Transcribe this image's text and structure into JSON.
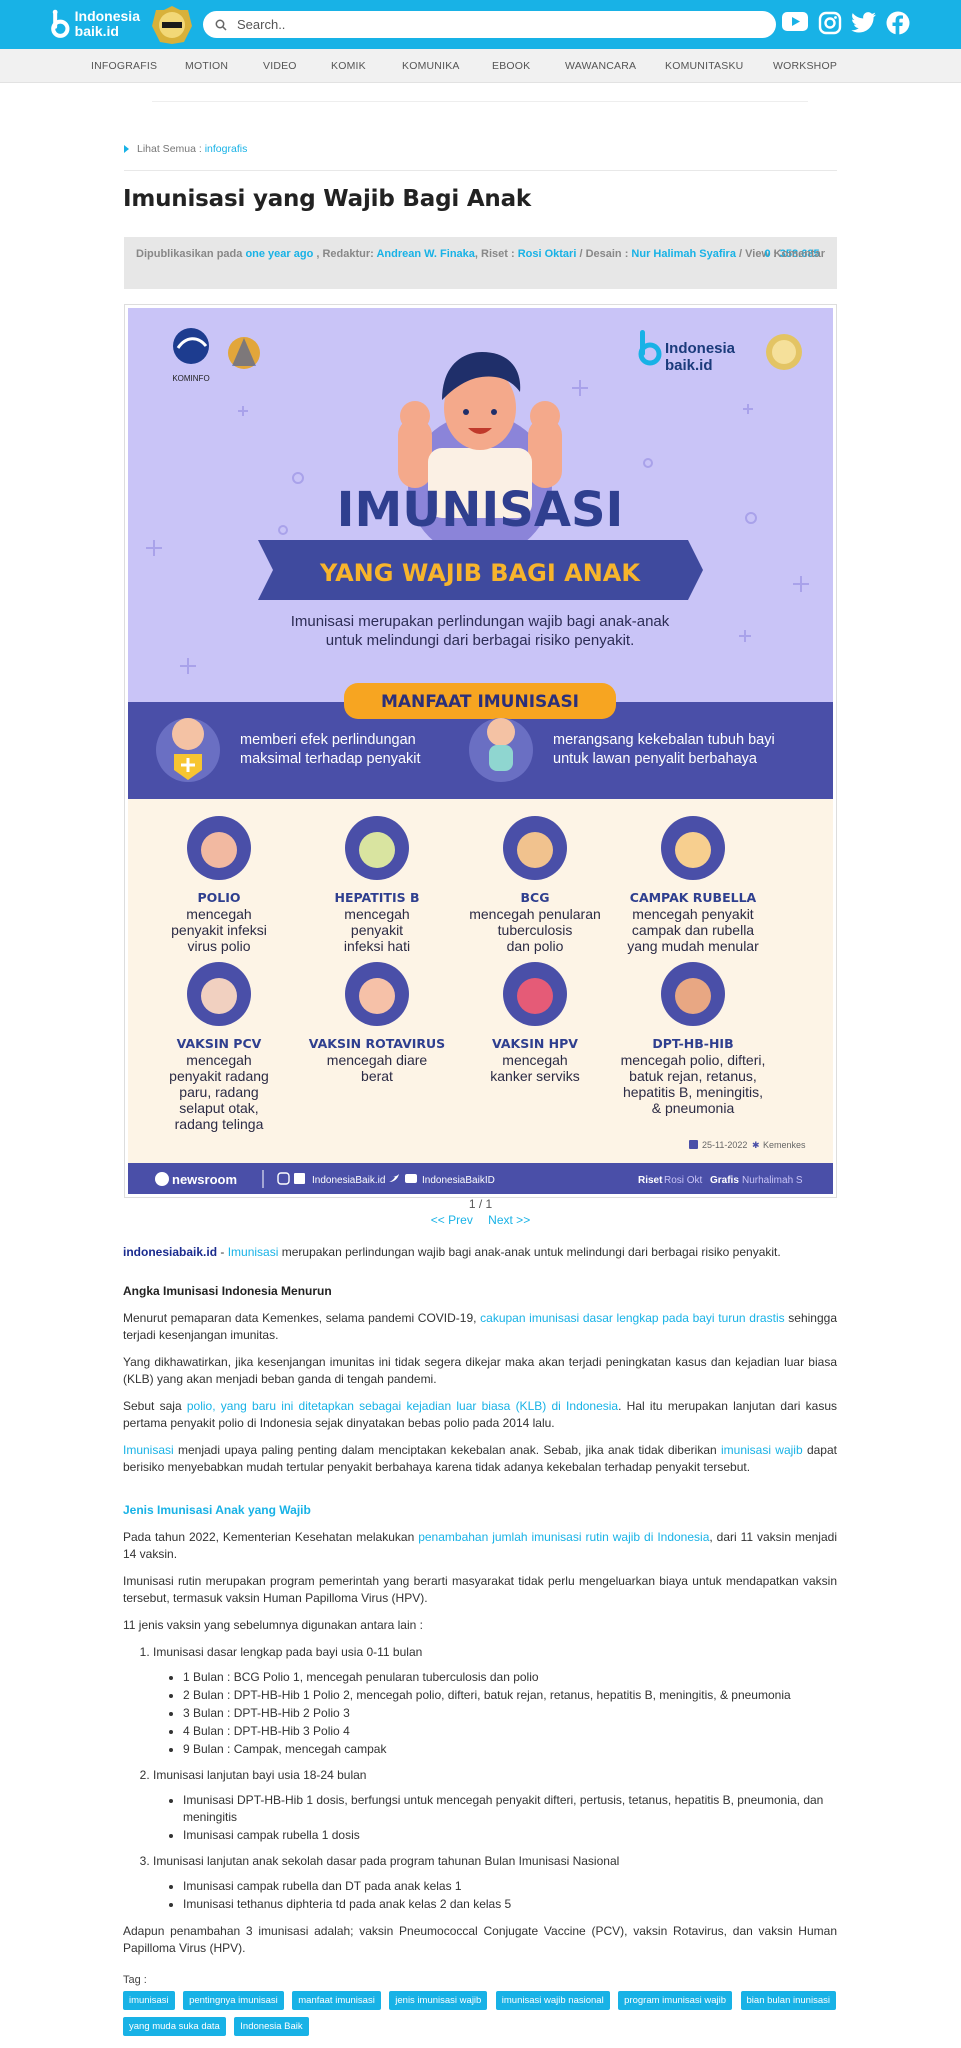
{
  "header": {
    "logo_text_1": "Indonesia",
    "logo_text_2": "baik.id",
    "search_placeholder": "Search..",
    "social": [
      "youtube-icon",
      "instagram-icon",
      "twitter-icon",
      "facebook-icon"
    ],
    "brand_color": "#18b2e6"
  },
  "nav": {
    "items": [
      "INFOGRAFIS",
      "MOTION",
      "VIDEO",
      "KOMIK",
      "KOMUNIKA",
      "EBOOK",
      "WAWANCARA",
      "KOMUNITASKU",
      "WORKSHOP"
    ]
  },
  "breadcrumb": {
    "prefix": "Lihat Semua : ",
    "link": "infografis"
  },
  "article": {
    "title": "Imunisasi yang Wajib Bagi Anak",
    "meta": {
      "published_label": "Dipublikasikan pada",
      "published_value": "one year ago",
      "editor_label": ", Redaktur:",
      "editor_value": "Andrean W. Finaka",
      "research_label": ", Riset :",
      "research_value": "Rosi Oktari",
      "design_label": "/ Desain :",
      "design_value": "Nur Halimah Syafira",
      "view_label": "/   View :",
      "view_value": "358.685",
      "comments_count": "0",
      "comments_label": "Komentar"
    }
  },
  "infographic": {
    "kominfo": "KOMINFO",
    "brand_1": "Indonesia",
    "brand_2": "baik.id",
    "headline": "IMUNISASI",
    "subheadline": "YANG WAJIB BAGI ANAK",
    "intro_1": "Imunisasi merupakan perlindungan wajib bagi anak-anak",
    "intro_2": "untuk melindungi dari berbagai risiko penyakit.",
    "benefit_title": "MANFAAT IMUNISASI",
    "benefit_1a": "memberi efek perlindungan",
    "benefit_1b": "maksimal terhadap penyakit",
    "benefit_2a": "merangsang kekebalan tubuh bayi",
    "benefit_2b": "untuk lawan penyalit berbahaya",
    "vaccines": [
      {
        "name": "POLIO",
        "lines": [
          "mencegah",
          "penyakit infeksi",
          "virus polio"
        ]
      },
      {
        "name": "HEPATITIS B",
        "lines": [
          "mencegah",
          "penyakit",
          "infeksi hati"
        ]
      },
      {
        "name": "BCG",
        "lines": [
          "mencegah penularan",
          "tuberculosis",
          "dan polio"
        ]
      },
      {
        "name": "CAMPAK RUBELLA",
        "lines": [
          "mencegah penyakit",
          "campak dan rubella",
          "yang mudah menular"
        ]
      },
      {
        "name": "VAKSIN PCV",
        "lines": [
          "mencegah",
          "penyakit radang",
          "paru, radang",
          "selaput otak,",
          "radang telinga"
        ]
      },
      {
        "name": "VAKSIN ROTAVIRUS",
        "lines": [
          "mencegah diare",
          "berat"
        ]
      },
      {
        "name": "VAKSIN HPV",
        "lines": [
          "mencegah",
          "kanker serviks"
        ]
      },
      {
        "name": "DPT-HB-HIB",
        "lines": [
          "mencegah polio, difteri,",
          "batuk rejan, retanus,",
          "hepatitis B, meningitis,",
          "& pneumonia"
        ]
      }
    ],
    "date": "25-11-2022",
    "source": "Kemenkes",
    "footer_newsroom": "newsroom",
    "footer_handle_1": "IndonesiaBaik.id",
    "footer_handle_2": "IndonesiaBaikID",
    "footer_riset_label": "Riset",
    "footer_riset_value": "Rosi Okt",
    "footer_grafis_label": "Grafis",
    "footer_grafis_value": "Nurhalimah S",
    "colors": {
      "lavender": "#c9c4f7",
      "indigo": "#4a4fa8",
      "orange": "#f7a521",
      "cream": "#fdf4e6"
    }
  },
  "pager": {
    "count": "1 / 1",
    "prev": "<<  Prev",
    "next": "Next  >>"
  },
  "body": {
    "lead_src": "indonesiabaik.id",
    "lead_sep": " - ",
    "lead_link": "Imunisasi",
    "lead_rest": " merupakan perlindungan wajib bagi anak-anak untuk melindungi dari berbagai risiko penyakit.",
    "h1": "Angka Imunisasi Indonesia Menurun",
    "p1a": "Menurut pemaparan data Kemenkes, selama pandemi COVID-19, ",
    "p1link": "cakupan imunisasi dasar lengkap pada bayi turun drastis",
    "p1b": " sehingga terjadi kesenjangan imunitas.",
    "p2": "Yang dikhawatirkan, jika kesenjangan imunitas ini tidak segera dikejar maka akan terjadi peningkatan kasus dan kejadian luar biasa (KLB) yang akan menjadi beban ganda di tengah pandemi.",
    "p3a": "Sebut saja ",
    "p3link": "polio, yang baru ini ditetapkan sebagai kejadian luar biasa (KLB) di Indonesia",
    "p3b": ". Hal itu merupakan lanjutan dari kasus pertama penyakit polio di Indonesia sejak dinyatakan bebas polio pada 2014 lalu.",
    "p4link1": "Imunisasi",
    "p4a": " menjadi upaya paling penting dalam menciptakan kekebalan anak. Sebab, jika anak tidak diberikan ",
    "p4link2": "imunisasi wajib",
    "p4b": " dapat berisiko menyebabkan mudah tertular penyakit berbahaya karena tidak adanya kekebalan terhadap penyakit tersebut.",
    "h2": "Jenis Imunisasi Anak yang Wajib",
    "p5a": "Pada tahun 2022, Kementerian Kesehatan melakukan ",
    "p5link": "penambahan jumlah imunisasi rutin wajib di Indonesia",
    "p5b": ", dari 11 vaksin menjadi 14 vaksin.",
    "p6": "Imunisasi rutin merupakan program pemerintah yang berarti masyarakat tidak perlu mengeluarkan biaya untuk mendapatkan vaksin tersebut, termasuk vaksin Human Papilloma Virus (HPV).",
    "p7": "11 jenis vaksin yang sebelumnya digunakan antara lain :",
    "list": [
      {
        "title": "Imunisasi dasar lengkap pada bayi usia 0-11 bulan",
        "items": [
          "1 Bulan : BCG Polio 1, mencegah penularan tuberculosis dan polio",
          "2 Bulan : DPT-HB-Hib 1 Polio 2, mencegah polio, difteri, batuk rejan, retanus, hepatitis B, meningitis, & pneumonia",
          "3 Bulan : DPT-HB-Hib 2 Polio 3",
          "4 Bulan : DPT-HB-Hib 3 Polio 4",
          "9 Bulan : Campak, mencegah campak"
        ]
      },
      {
        "title": "Imunisasi lanjutan bayi usia 18-24 bulan",
        "items": [
          "Imunisasi DPT-HB-Hib 1 dosis, berfungsi untuk mencegah penyakit difteri, pertusis, tetanus, hepatitis B, pneumonia, dan meningitis",
          "Imunisasi campak rubella 1 dosis"
        ]
      },
      {
        "title": "Imunisasi lanjutan anak sekolah dasar pada program tahunan Bulan Imunisasi Nasional",
        "items": [
          "Imunisasi campak rubella dan DT pada anak kelas 1",
          "Imunisasi tethanus diphteria td pada anak kelas 2 dan kelas 5"
        ]
      }
    ],
    "p8": "Adapun penambahan 3 imunisasi adalah; vaksin Pneumococcal Conjugate Vaccine (PCV), vaksin Rotavirus, dan vaksin Human Papilloma Virus (HPV)."
  },
  "tags": {
    "label": "Tag :",
    "items": [
      "imunisasi",
      "pentingnya imunisasi",
      "manfaat imunisasi",
      "jenis imunisasi wajib",
      "imunisasi wajib nasional",
      "program imunisasi wajib",
      "bian bulan inunisasi",
      "yang muda suka data",
      "Indonesia Baik"
    ]
  }
}
